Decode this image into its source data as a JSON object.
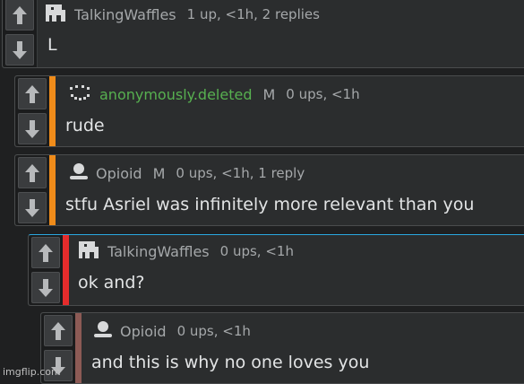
{
  "comments": [
    {
      "username": "TalkingWaffles",
      "username_color": "#a5a8aa",
      "badge": "",
      "meta": "1 up, <1h, 2 replies",
      "body": "L",
      "bar_color": "none",
      "avatar": "waffle-avatar-icon"
    },
    {
      "username": "anonymously.deleted",
      "username_color": "#57b050",
      "badge": "M",
      "meta": "0 ups, <1h",
      "body": "rude",
      "bar_color": "#f08c1a",
      "avatar": "dots-smile-avatar-icon"
    },
    {
      "username": "Opioid",
      "username_color": "#a5a8aa",
      "badge": "M",
      "meta": "0 ups, <1h, 1 reply",
      "body": "stfu Asriel was infinitely more relevant than you",
      "bar_color": "#f08c1a",
      "avatar": "user-silhouette-icon"
    },
    {
      "username": "TalkingWaffles",
      "username_color": "#a5a8aa",
      "badge": "",
      "meta": "0 ups, <1h",
      "body": "ok and?",
      "bar_color": "#e62c2c",
      "avatar": "waffle-avatar-icon"
    },
    {
      "username": "Opioid",
      "username_color": "#a5a8aa",
      "badge": "",
      "meta": "0 ups, <1h",
      "body": "and this is why no one loves you",
      "bar_color": "#8c5a55",
      "avatar": "user-silhouette-icon"
    }
  ],
  "watermark": "imgflip.com"
}
